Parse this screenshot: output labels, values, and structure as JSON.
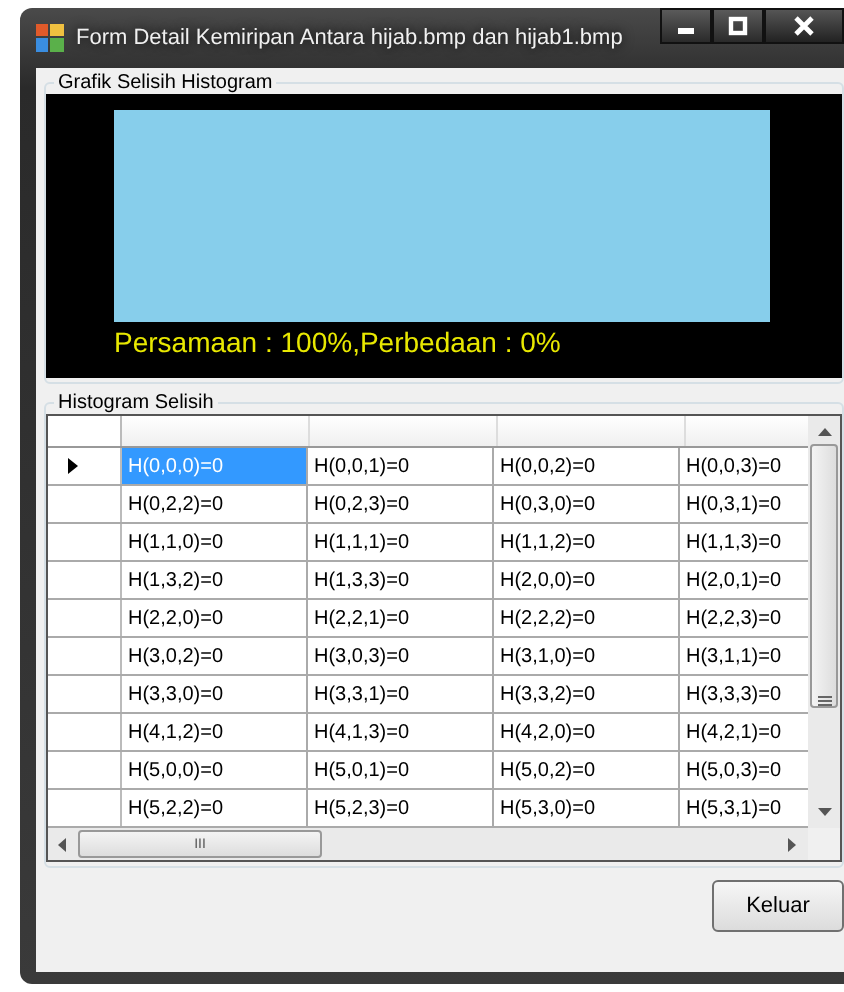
{
  "window": {
    "title": "Form Detail Kemiripan Antara hijab.bmp dan hijab1.bmp"
  },
  "chart_group": {
    "title": "Grafik Selisih Histogram",
    "result_text": "Persamaan : 100%,Perbedaan : 0%"
  },
  "grid_group": {
    "title": "Histogram Selisih"
  },
  "table": {
    "rows": [
      {
        "current": true,
        "cells": [
          {
            "text": "H(0,0,0)=0",
            "selected": true
          },
          {
            "text": "H(0,0,1)=0",
            "selected": false
          },
          {
            "text": "H(0,0,2)=0",
            "selected": false
          },
          {
            "text": "H(0,0,3)=0",
            "selected": false
          }
        ]
      },
      {
        "current": false,
        "cells": [
          {
            "text": "H(0,2,2)=0",
            "selected": false
          },
          {
            "text": "H(0,2,3)=0",
            "selected": false
          },
          {
            "text": "H(0,3,0)=0",
            "selected": false
          },
          {
            "text": "H(0,3,1)=0",
            "selected": false
          }
        ]
      },
      {
        "current": false,
        "cells": [
          {
            "text": "H(1,1,0)=0",
            "selected": false
          },
          {
            "text": "H(1,1,1)=0",
            "selected": false
          },
          {
            "text": "H(1,1,2)=0",
            "selected": false
          },
          {
            "text": "H(1,1,3)=0",
            "selected": false
          }
        ]
      },
      {
        "current": false,
        "cells": [
          {
            "text": "H(1,3,2)=0",
            "selected": false
          },
          {
            "text": "H(1,3,3)=0",
            "selected": false
          },
          {
            "text": "H(2,0,0)=0",
            "selected": false
          },
          {
            "text": "H(2,0,1)=0",
            "selected": false
          }
        ]
      },
      {
        "current": false,
        "cells": [
          {
            "text": "H(2,2,0)=0",
            "selected": false
          },
          {
            "text": "H(2,2,1)=0",
            "selected": false
          },
          {
            "text": "H(2,2,2)=0",
            "selected": false
          },
          {
            "text": "H(2,2,3)=0",
            "selected": false
          }
        ]
      },
      {
        "current": false,
        "cells": [
          {
            "text": "H(3,0,2)=0",
            "selected": false
          },
          {
            "text": "H(3,0,3)=0",
            "selected": false
          },
          {
            "text": "H(3,1,0)=0",
            "selected": false
          },
          {
            "text": "H(3,1,1)=0",
            "selected": false
          }
        ]
      },
      {
        "current": false,
        "cells": [
          {
            "text": "H(3,3,0)=0",
            "selected": false
          },
          {
            "text": "H(3,3,1)=0",
            "selected": false
          },
          {
            "text": "H(3,3,2)=0",
            "selected": false
          },
          {
            "text": "H(3,3,3)=0",
            "selected": false
          }
        ]
      },
      {
        "current": false,
        "cells": [
          {
            "text": "H(4,1,2)=0",
            "selected": false
          },
          {
            "text": "H(4,1,3)=0",
            "selected": false
          },
          {
            "text": "H(4,2,0)=0",
            "selected": false
          },
          {
            "text": "H(4,2,1)=0",
            "selected": false
          }
        ]
      },
      {
        "current": false,
        "cells": [
          {
            "text": "H(5,0,0)=0",
            "selected": false
          },
          {
            "text": "H(5,0,1)=0",
            "selected": false
          },
          {
            "text": "H(5,0,2)=0",
            "selected": false
          },
          {
            "text": "H(5,0,3)=0",
            "selected": false
          }
        ]
      },
      {
        "current": false,
        "cells": [
          {
            "text": "H(5,2,2)=0",
            "selected": false
          },
          {
            "text": "H(5,2,3)=0",
            "selected": false
          },
          {
            "text": "H(5,3,0)=0",
            "selected": false
          },
          {
            "text": "H(5,3,1)=0",
            "selected": false
          }
        ]
      }
    ],
    "horizontal_scroll_thumb": "III"
  },
  "buttons": [
    {
      "label": "Keluar"
    }
  ]
}
